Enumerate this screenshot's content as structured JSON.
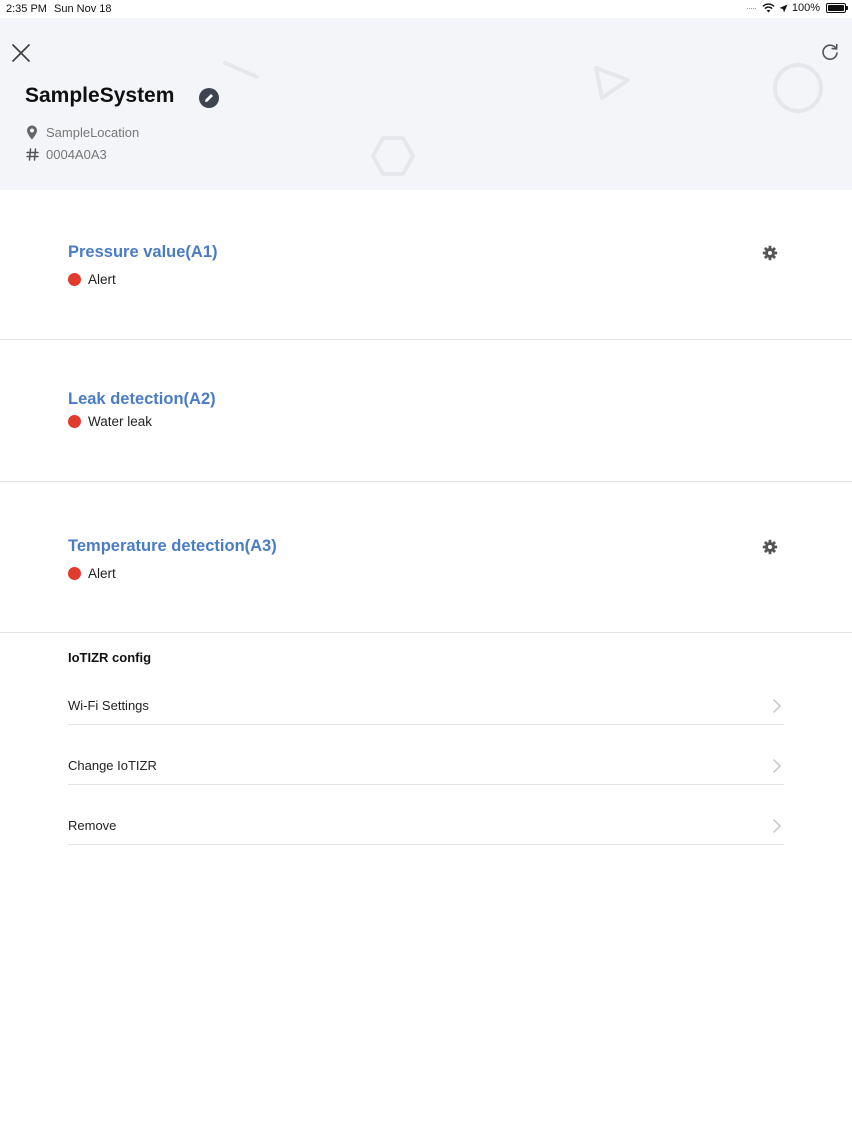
{
  "status_bar": {
    "time": "2:35 PM",
    "date": "Sun Nov 18",
    "battery_percent": "100%",
    "battery_level": 1.0
  },
  "header": {
    "title": "SampleSystem",
    "location": "SampleLocation",
    "system_id": "0004A0A3",
    "icons": {
      "close": "close-icon",
      "refresh": "refresh-icon",
      "edit": "pencil-icon",
      "location": "location-pin-icon",
      "id": "hash-icon"
    },
    "background_color": "#f4f5f9"
  },
  "sensors": [
    {
      "title": "Pressure value(A1)",
      "status": "Alert",
      "status_color": "#e23b2d",
      "has_settings": true
    },
    {
      "title": "Leak detection(A2)",
      "status": "Water leak",
      "status_color": "#e23b2d",
      "has_settings": false
    },
    {
      "title": "Temperature detection(A3)",
      "status": "Alert",
      "status_color": "#e23b2d",
      "has_settings": true
    }
  ],
  "config": {
    "title": "IoTIZR config",
    "items": [
      {
        "label": "Wi-Fi Settings"
      },
      {
        "label": "Change IoTIZR"
      },
      {
        "label": "Remove"
      }
    ]
  },
  "colors": {
    "accent_blue": "#4a7cc5",
    "alert_red": "#e23b2d",
    "divider": "#e3e4e8"
  }
}
